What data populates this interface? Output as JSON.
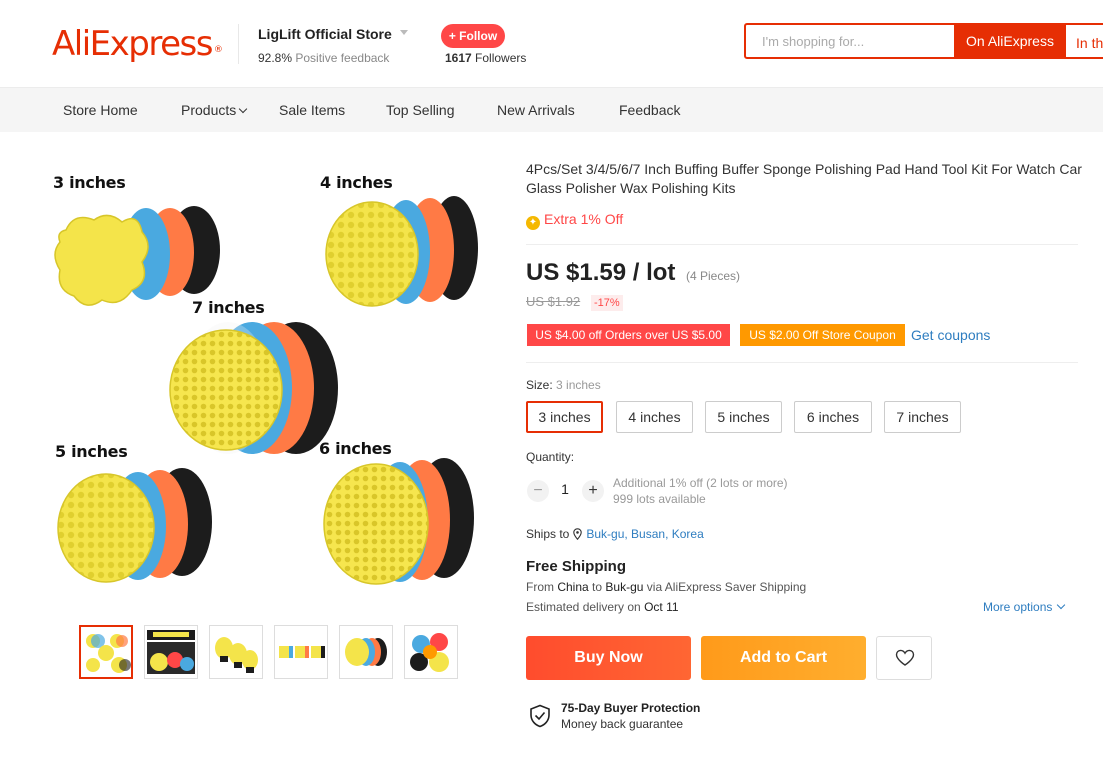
{
  "header": {
    "logo": "AliExpress",
    "logo_mark": "®",
    "store_name": "LigLift Official Store",
    "feedback_pct": "92.8%",
    "feedback_label": "Positive feedback",
    "follow_label": "+ Follow",
    "followers_count": "1617",
    "followers_label": "Followers",
    "search_placeholder": "I'm shopping for...",
    "search_on": "On AliExpress",
    "search_in": "In th"
  },
  "nav": {
    "items": [
      {
        "label": "Store Home"
      },
      {
        "label": "Products"
      },
      {
        "label": "Sale Items"
      },
      {
        "label": "Top Selling"
      },
      {
        "label": "New Arrivals"
      },
      {
        "label": "Feedback"
      }
    ]
  },
  "gallery": {
    "labels": [
      "3 inches",
      "4 inches",
      "7 inches",
      "5 inches",
      "6 inches"
    ],
    "thumbnail_count": 6,
    "active_thumbnail": 1
  },
  "product": {
    "title": "4Pcs/Set 3/4/5/6/7 Inch Buffing Buffer Sponge Polishing Pad Hand Tool Kit For Watch Car Glass Polisher Wax Polishing Kits",
    "extra_off": "Extra 1% Off",
    "price": "US $1.59 / lot",
    "pieces": "(4 Pieces)",
    "old_price": "US $1.92",
    "discount": "-17%",
    "coupon1": "US $4.00 off Orders over US $5.00",
    "coupon2": "US $2.00 Off Store Coupon",
    "get_coupons": "Get coupons",
    "size_label": "Size:",
    "size_selected": "3 inches",
    "sizes": [
      "3 inches",
      "4 inches",
      "5 inches",
      "6 inches",
      "7 inches"
    ],
    "quantity_label": "Quantity:",
    "quantity": "1",
    "qty_minus": "−",
    "qty_plus": "+",
    "qty_note": "Additional 1% off (2 lots or more)",
    "qty_available": "999 lots available",
    "ships_to_label": "Ships to",
    "ships_to_location": "Buk-gu, Busan, Korea",
    "free_shipping": "Free Shipping",
    "ship_from_prefix": "From",
    "ship_from_country": "China",
    "ship_to_word": "to",
    "ship_to_city": "Buk-gu",
    "ship_via": "via AliExpress Saver Shipping",
    "est_label": "Estimated delivery on",
    "est_date": "Oct 11",
    "more_options": "More options",
    "buy_now": "Buy Now",
    "add_to_cart": "Add to Cart",
    "protection_title": "75-Day Buyer Protection",
    "protection_sub": "Money back guarantee"
  },
  "colors": {
    "brand": "#e62e04",
    "accent_red": "#ff4747",
    "orange": "#ff9900",
    "link": "#2e7dc0",
    "pad_yellow": "#f4e44a",
    "pad_blue": "#4aa9e0",
    "pad_orange": "#ff7a45",
    "pad_black": "#1c1c1c"
  },
  "icons": {
    "coin": "coin-icon",
    "pin": "location-pin-icon",
    "heart": "heart-icon",
    "shield": "shield-check-icon"
  }
}
